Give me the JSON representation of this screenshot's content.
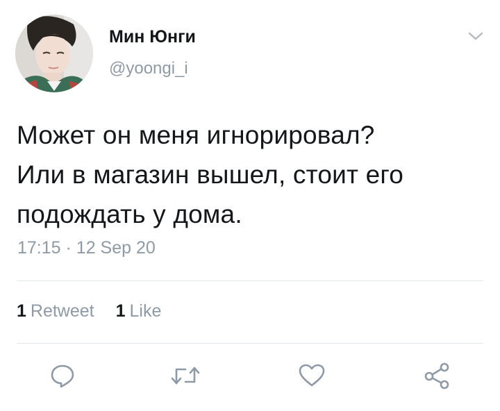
{
  "author": {
    "display_name": "Мин Юнги",
    "handle": "@yoongi_i"
  },
  "tweet": {
    "lines": [
      "Может он меня игнорировал?",
      "Или в магазин вышел, стоит его",
      "подождать у дома."
    ],
    "time": "17:15",
    "separator": "·",
    "date": "12 Sep 20"
  },
  "stats": {
    "retweets_count": "1",
    "retweets_label": "Retweet",
    "likes_count": "1",
    "likes_label": "Like"
  },
  "icons": {
    "menu": "chevron-down-icon",
    "reply": "reply-icon",
    "retweet": "retweet-icon",
    "like": "heart-icon",
    "share": "share-icon"
  },
  "colors": {
    "text": "#14171a",
    "secondary": "#8e9aa5",
    "divider": "#e1e8ed",
    "icon": "#8e9aa5"
  }
}
